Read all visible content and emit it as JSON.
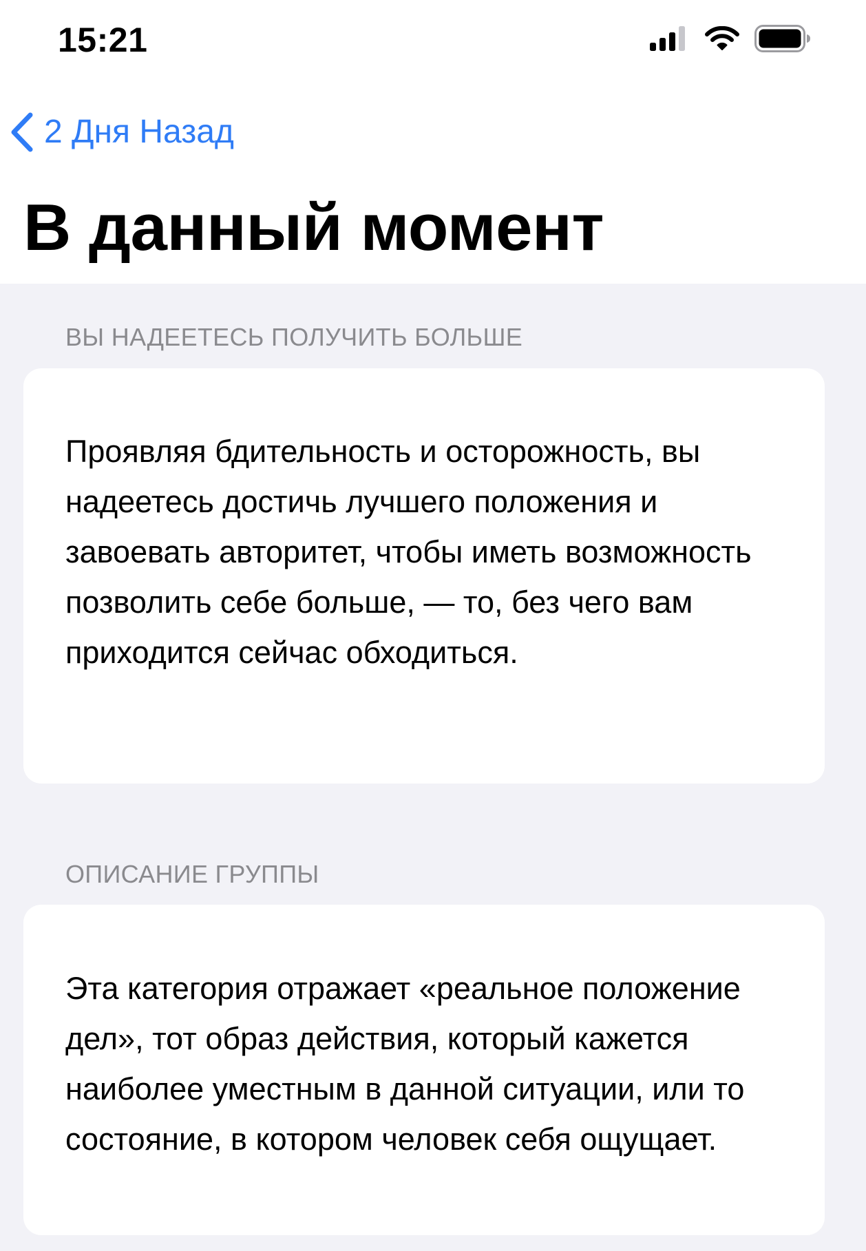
{
  "status_bar": {
    "time": "15:21",
    "icons": [
      "cellular-signal-icon",
      "wifi-icon",
      "battery-icon"
    ]
  },
  "nav": {
    "back_label": "2 Дня Назад",
    "back_icon": "chevron-left-icon"
  },
  "page": {
    "title": "В данный момент"
  },
  "sections": [
    {
      "header": "ВЫ НАДЕЕТЕСЬ ПОЛУЧИТЬ БОЛЬШЕ",
      "body": "Проявляя бдительность и осторожность, вы надеетесь достичь лучшего положения и завоевать авторитет, чтобы иметь возможность позволить себе больше, — то, без чего вам приходится сейчас обходиться."
    },
    {
      "header": "ОПИСАНИЕ ГРУППЫ",
      "body": "Эта категория отражает «реальное положение дел», тот образ действия, который кажется наиболее уместным в данной ситуации, или то состояние, в котором человек себя ощущает."
    }
  ],
  "colors": {
    "accent": "#2f7cf6",
    "background": "#f2f2f7",
    "card": "#ffffff",
    "secondary_text": "#8a8a8e"
  }
}
